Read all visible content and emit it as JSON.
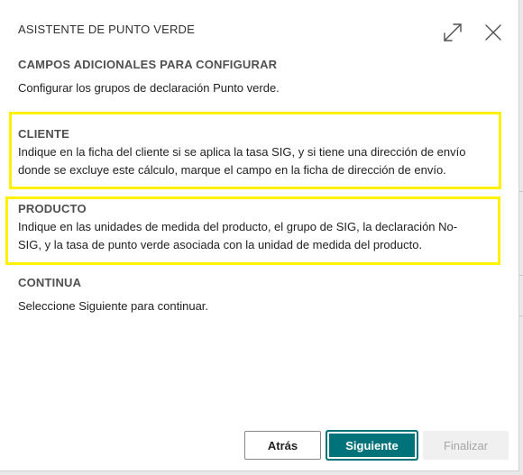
{
  "dialog": {
    "title": "ASISTENTE DE PUNTO VERDE"
  },
  "header": {
    "heading": "CAMPOS ADICIONALES PARA CONFIGURAR",
    "intro": "Configurar los grupos de declaración Punto verde."
  },
  "sections": {
    "cliente": {
      "heading": "CLIENTE",
      "line1": "Indique en la ficha del cliente si se aplica la tasa SIG, y si tiene una dirección de envío",
      "line2": "donde se excluye este cálculo, marque el campo en la ficha de dirección de envío."
    },
    "producto": {
      "heading": "PRODUCTO",
      "line1": "Indique en las unidades de medida del producto, el grupo de SIG, la declaración No-",
      "line2": "SIG, y la tasa de punto verde asociada con la unidad de medida del producto."
    },
    "continua": {
      "heading": "CONTINUA",
      "text": "Seleccione Siguiente para continuar."
    }
  },
  "footer": {
    "back_label": "Atrás",
    "next_label": "Siguiente",
    "finish_label": "Finalizar"
  },
  "icons": {
    "expand": "expand-icon",
    "close": "close-icon"
  },
  "colors": {
    "primary": "#00737a",
    "highlight": "#fff200",
    "disabled_bg": "#f0f0f0",
    "disabled_text": "#a6a6a6"
  }
}
